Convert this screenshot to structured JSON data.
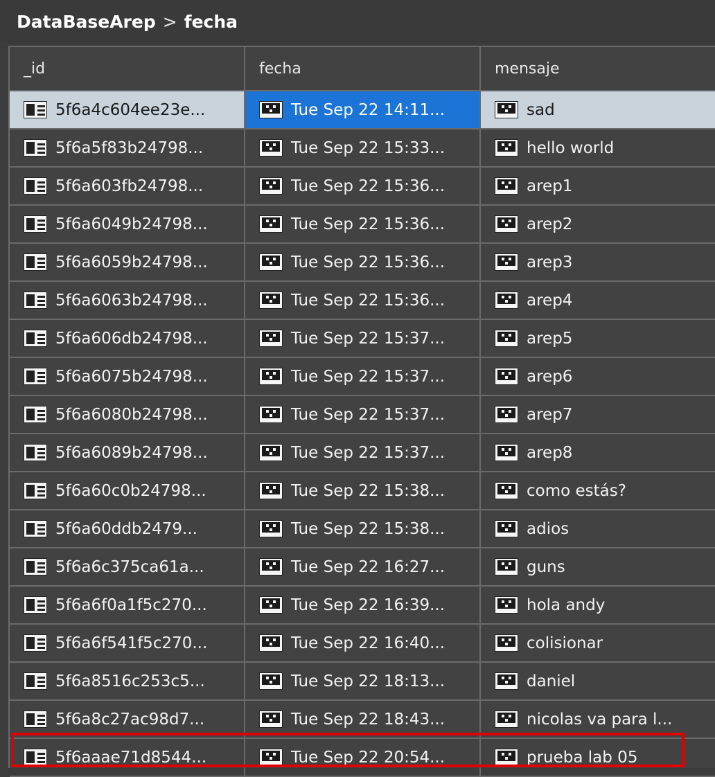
{
  "breadcrumb": {
    "database": "DataBaseArep",
    "separator": ">",
    "collection": "fecha"
  },
  "columns": {
    "id": "_id",
    "fecha": "fecha",
    "mensaje": "mensaje"
  },
  "icons": {
    "id_type": "document-icon",
    "string_type": "string-icon"
  },
  "colors": {
    "selected_row": "#c9d3dc",
    "selected_cell": "#1b74d6",
    "highlight_border": "#e00000"
  },
  "rows": [
    {
      "id": "5f6a4c604ee23e...",
      "fecha": "Tue Sep 22 14:11...",
      "mensaje": "sad"
    },
    {
      "id": "5f6a5f83b24798...",
      "fecha": "Tue Sep 22 15:33...",
      "mensaje": "hello world"
    },
    {
      "id": "5f6a603fb24798...",
      "fecha": "Tue Sep 22 15:36...",
      "mensaje": "arep1"
    },
    {
      "id": "5f6a6049b24798...",
      "fecha": "Tue Sep 22 15:36...",
      "mensaje": "arep2"
    },
    {
      "id": "5f6a6059b24798...",
      "fecha": "Tue Sep 22 15:36...",
      "mensaje": "arep3"
    },
    {
      "id": "5f6a6063b24798...",
      "fecha": "Tue Sep 22 15:36...",
      "mensaje": "arep4"
    },
    {
      "id": "5f6a606db24798...",
      "fecha": "Tue Sep 22 15:37...",
      "mensaje": "arep5"
    },
    {
      "id": "5f6a6075b24798...",
      "fecha": "Tue Sep 22 15:37...",
      "mensaje": "arep6"
    },
    {
      "id": "5f6a6080b24798...",
      "fecha": "Tue Sep 22 15:37...",
      "mensaje": "arep7"
    },
    {
      "id": "5f6a6089b24798...",
      "fecha": "Tue Sep 22 15:37...",
      "mensaje": "arep8"
    },
    {
      "id": "5f6a60c0b24798...",
      "fecha": "Tue Sep 22 15:38...",
      "mensaje": "como estás?"
    },
    {
      "id": "5f6a60ddb2479...",
      "fecha": "Tue Sep 22 15:38...",
      "mensaje": "adios"
    },
    {
      "id": "5f6a6c375ca61a...",
      "fecha": "Tue Sep 22 16:27...",
      "mensaje": "guns"
    },
    {
      "id": "5f6a6f0a1f5c270...",
      "fecha": "Tue Sep 22 16:39...",
      "mensaje": "hola andy"
    },
    {
      "id": "5f6a6f541f5c270...",
      "fecha": "Tue Sep 22 16:40...",
      "mensaje": "colisionar"
    },
    {
      "id": "5f6a8516c253c5...",
      "fecha": "Tue Sep 22 18:13...",
      "mensaje": "daniel"
    },
    {
      "id": "5f6a8c27ac98d7...",
      "fecha": "Tue Sep 22 18:43...",
      "mensaje": "nicolas va para l..."
    },
    {
      "id": "5f6aaae71d8544...",
      "fecha": "Tue Sep 22 20:54...",
      "mensaje": "prueba lab 05"
    }
  ]
}
